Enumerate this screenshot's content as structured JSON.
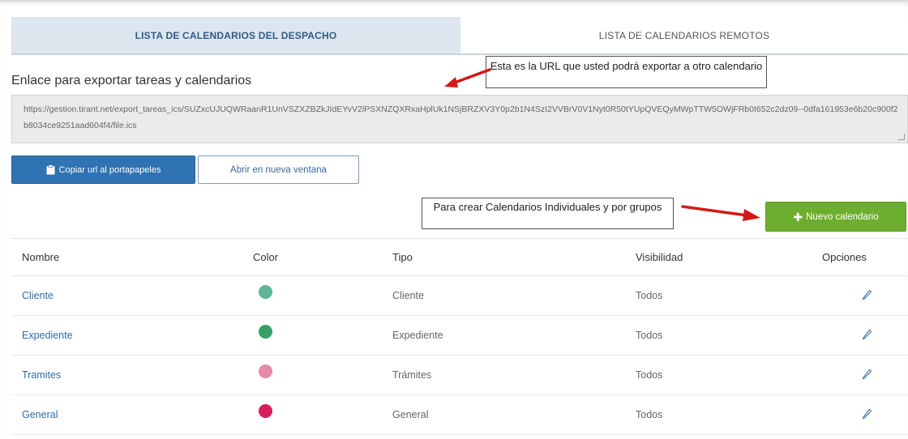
{
  "tabs": [
    {
      "label": "LISTA DE CALENDARIOS DEL DESPACHO",
      "active": true
    },
    {
      "label": "LISTA DE CALENDARIOS REMOTOS",
      "active": false
    }
  ],
  "export": {
    "title": "Enlace para exportar tareas y calendarios",
    "url": "https://gestion.tirant.net/export_tareas_ics/SUZxcUJUQWRaanR1UnVSZXZBZkJIdEYvV2lPSXNZQXRxaHplUk1NSjBRZXV3Y0p2b1N4SzI2VVBrV0V1Nyt0R50tYUpQVEQyMWpTTW5OWjFRb0t652c2dz09--0dfa161953e6b20c900f2b8034ce9251aad604f4/file.ics"
  },
  "callouts": {
    "url_note": "Esta es la URL que usted podrá exportar a otro calendario",
    "create_note": "Para crear Calendarios Individuales y por grupos"
  },
  "buttons": {
    "copy_label": "Copiar url al portapapeles",
    "open_label": "Abrir en nueva ventana",
    "new_label": "Nuevo calendario"
  },
  "table": {
    "headers": {
      "name": "Nombre",
      "color": "Color",
      "type": "Tipo",
      "visibility": "Visibilidad",
      "options": "Opciones"
    },
    "rows": [
      {
        "name": "Cliente",
        "color": "#5fb596",
        "type": "Cliente",
        "visibility": "Todos"
      },
      {
        "name": "Expediente",
        "color": "#36a065",
        "type": "Expediente",
        "visibility": "Todos"
      },
      {
        "name": "Tramites",
        "color": "#e589a6",
        "type": "Trámites",
        "visibility": "Todos"
      },
      {
        "name": "General",
        "color": "#d81e5b",
        "type": "General",
        "visibility": "Todos"
      }
    ]
  },
  "icons": {
    "clipboard": "clipboard-icon",
    "plus": "plus-icon",
    "edit": "pencil-icon",
    "arrow": "red-arrow-icon"
  },
  "colors": {
    "tab_active_bg": "#dde5ee",
    "primary_button": "#2f73b2",
    "success_button": "#6eae2f",
    "arrow": "#d41818",
    "link": "#2f6ca7"
  }
}
